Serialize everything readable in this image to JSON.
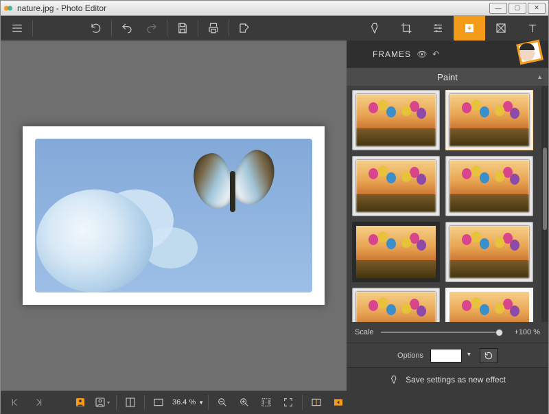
{
  "window": {
    "title": "nature.jpg - Photo Editor"
  },
  "toolbar": {
    "menu": "menu-icon",
    "undo_history": "undo-history-icon",
    "undo": "undo-icon",
    "redo": "redo-icon",
    "save": "save-icon",
    "print": "print-icon",
    "export": "export-icon",
    "tabs": [
      {
        "name": "adjustments-tab",
        "icon": "flask-icon",
        "active": false
      },
      {
        "name": "crop-tab",
        "icon": "crop-icon",
        "active": false
      },
      {
        "name": "tune-tab",
        "icon": "sliders-icon",
        "active": false
      },
      {
        "name": "frames-tab",
        "icon": "frame-download-icon",
        "active": true
      },
      {
        "name": "textures-tab",
        "icon": "texture-icon",
        "active": false
      },
      {
        "name": "text-tab",
        "icon": "text-icon",
        "active": false
      }
    ]
  },
  "frames_panel": {
    "title": "FRAMES",
    "visibility_icon": "eye-icon",
    "reset_icon": "undo-icon",
    "category": "Paint",
    "thumbs": [
      {
        "id": "frame-01",
        "style": "rough",
        "selected": false
      },
      {
        "id": "frame-02",
        "style": "rough",
        "selected": true
      },
      {
        "id": "frame-03",
        "style": "rough",
        "selected": false
      },
      {
        "id": "frame-04",
        "style": "rough",
        "selected": false
      },
      {
        "id": "frame-05",
        "style": "none",
        "selected": false
      },
      {
        "id": "frame-06",
        "style": "rough",
        "selected": false
      },
      {
        "id": "frame-07",
        "style": "rough",
        "selected": false
      },
      {
        "id": "frame-08",
        "style": "scribble",
        "selected": false
      }
    ],
    "scale": {
      "label": "Scale",
      "value_text": "+100 %",
      "value": 100,
      "min": 0,
      "max": 200
    },
    "options": {
      "label": "Options",
      "color": "#ffffff"
    },
    "save_effect": "Save settings as new effect"
  },
  "bottombar": {
    "prev": "prev-image-icon",
    "next": "next-image-icon",
    "compare_a": "compare-person-a-icon",
    "compare_b": "compare-person-b-icon",
    "layout": "layout-split-icon",
    "fit": "fit-screen-icon",
    "zoom_text": "36.4 %",
    "zoom_out": "zoom-out-icon",
    "zoom_in": "zoom-in-icon",
    "one_to_one": "one-to-one-icon",
    "fullscreen": "fullscreen-icon",
    "before": "before-icon",
    "apply": "apply-icon"
  }
}
